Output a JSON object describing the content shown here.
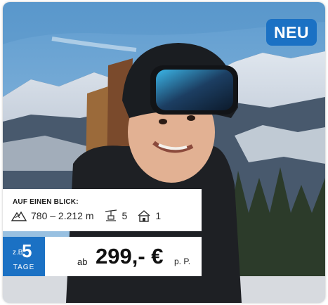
{
  "badge": {
    "label": "NEU"
  },
  "info": {
    "title": "AUF EINEN BLICK:",
    "altitude": "780 – 2.212 m",
    "lifts": "5",
    "accommodations": "1"
  },
  "duration": {
    "prefix": "z.B.",
    "days": "5",
    "unit": "TAGE"
  },
  "price": {
    "prefix": "ab",
    "amount": "299,- €",
    "suffix": "p. P."
  },
  "colors": {
    "accent": "#1b71c4",
    "panel": "#ffffff"
  },
  "icons": {
    "altitude": "mountain-icon",
    "lifts": "ski-lift-icon",
    "accommodation": "house-icon"
  }
}
